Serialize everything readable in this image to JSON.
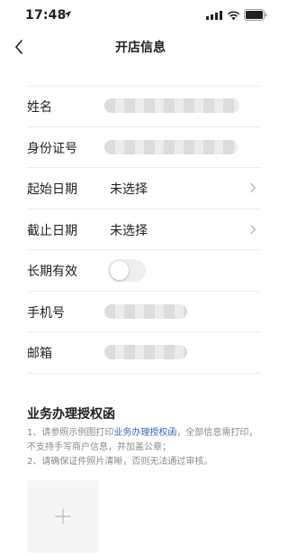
{
  "status_bar": {
    "time": "17:48"
  },
  "header": {
    "title": "开店信息"
  },
  "form": {
    "rows": [
      {
        "label": "姓名"
      },
      {
        "label": "身份证号"
      },
      {
        "label": "起始日期",
        "value": "未选择"
      },
      {
        "label": "截止日期",
        "value": "未选择"
      },
      {
        "label": "长期有效",
        "toggle_on": false
      },
      {
        "label": "手机号"
      },
      {
        "label": "邮箱"
      }
    ]
  },
  "authorization": {
    "title": "业务办理授权函",
    "note_line1_prefix": "1、请参照示例图打印",
    "note_link": "业务办理授权函",
    "note_line1_suffix": "，全部信息需打印，不支持手写商户信息，并加盖公章；",
    "note_line2": "2、请确保证件照片清晰，否则无法通过审核。"
  },
  "colors": {
    "link": "#3a5fcd",
    "divider": "#ededed",
    "muted_text": "#8a8a8a"
  },
  "icons": {
    "back": "chevron-left-icon",
    "row_arrow": "chevron-right-icon",
    "upload": "plus-icon"
  }
}
